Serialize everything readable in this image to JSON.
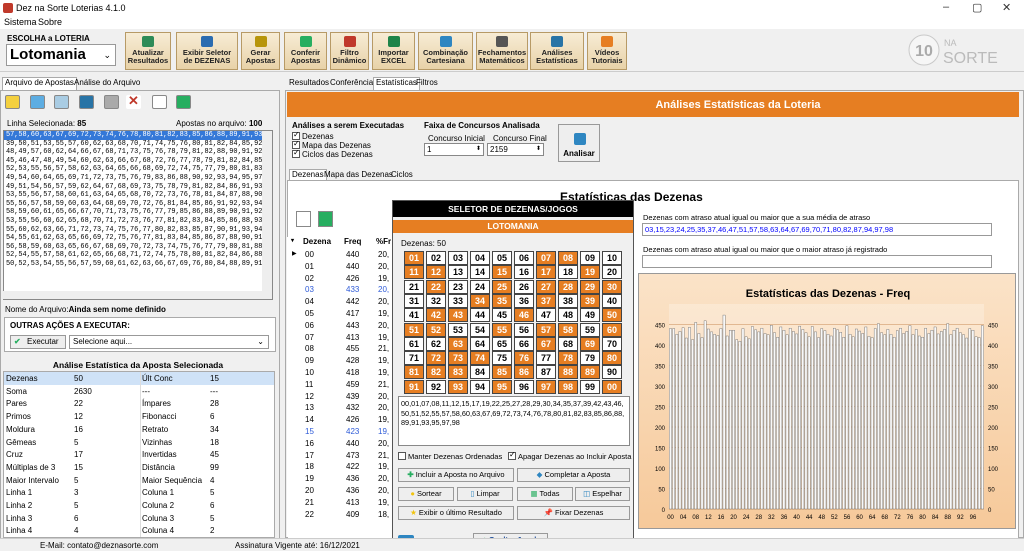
{
  "window": {
    "title": "Dez na Sorte Loterias 4.1.0"
  },
  "menu": [
    "Sistema",
    "Sobre"
  ],
  "loteria": {
    "label": "ESCOLHA a LOTERIA",
    "value": "Lotomania"
  },
  "toolbar": [
    {
      "l1": "Atualizar",
      "l2": "Resultados",
      "icon": "refresh-icon",
      "c": "#2e8b57"
    },
    {
      "l1": "Exibir Seletor",
      "l2": "de DEZENAS",
      "icon": "grid-icon",
      "c": "#2b6cb0"
    },
    {
      "l1": "Gerar",
      "l2": "Apostas",
      "icon": "generate-icon",
      "c": "#b7950b"
    },
    {
      "l1": "Conferir",
      "l2": "Apostas",
      "icon": "check-icon",
      "c": "#27ae60"
    },
    {
      "l1": "Filtro",
      "l2": "Dinâmico",
      "icon": "filter-icon",
      "c": "#c0392b"
    },
    {
      "l1": "Importar",
      "l2": "EXCEL",
      "icon": "excel-icon",
      "c": "#1e8449"
    },
    {
      "l1": "Combinação",
      "l2": "Cartesiana",
      "icon": "combination-icon",
      "c": "#2e86c1"
    },
    {
      "l1": "Fechamentos",
      "l2": "Matemáticos",
      "icon": "sigma-icon",
      "c": "#555555"
    },
    {
      "l1": "Análises",
      "l2": "Estatísticas",
      "icon": "stats-icon",
      "c": "#2874a6"
    },
    {
      "l1": "Vídeos",
      "l2": "Tutoriais",
      "icon": "video-icon",
      "c": "#e67e22"
    }
  ],
  "logo": {
    "num": "10",
    "line1": "NA",
    "line2": "SORTE"
  },
  "left_tabs": [
    "Arquivo de Apostas",
    "Análise do Arquivo"
  ],
  "linha_label": "Linha Selecionada:",
  "linha_value": "85",
  "apostas_label": "Apostas no arquivo:",
  "apostas_value": "100",
  "list_lines": [
    "57,58,60,63,67,69,72,73,74,76,78,80,81,82,83,85,86,88,89,91,93,95,97,98",
    "39,50,51,53,55,57,60,62,63,68,70,71,74,75,76,80,81,82,84,85,92,93,96,98",
    "48,49,57,60,62,64,66,67,68,71,73,75,76,78,79,81,82,88,90,91,92,93,95,98",
    "45,46,47,48,49,54,60,62,63,66,67,68,72,76,77,78,79,81,82,84,85,87,89,94",
    "52,53,55,56,57,58,62,63,64,65,66,68,69,72,74,75,77,79,80,81,83,86,91,96",
    "49,54,60,64,65,69,71,72,73,75,76,79,83,86,88,90,92,93,94,95,97,98,99",
    "49,51,54,56,57,59,62,64,67,68,69,73,75,78,79,81,82,84,86,91,93,95,97,98",
    "53,55,56,57,58,60,61,63,64,65,68,70,72,73,76,78,81,84,87,88,90,95,96,98",
    "55,56,57,58,59,60,63,64,68,69,70,72,76,81,84,85,86,91,92,93,94,95,97,98",
    "58,59,60,61,65,66,67,70,71,73,75,76,77,79,85,86,88,89,90,91,92,93,94,97",
    "53,55,56,60,62,65,68,70,71,72,73,76,77,81,82,83,84,85,86,88,93,94,97,99",
    "55,60,62,63,66,71,72,73,74,75,76,77,80,82,83,85,87,90,91,93,94,95,96,99",
    "54,55,61,62,63,65,66,69,72,75,76,77,81,83,84,85,86,87,88,90,91,92,94,99",
    "56,58,59,60,63,65,66,67,68,69,70,72,73,74,75,76,77,79,80,81,88,96,98,99",
    "52,54,55,57,58,61,62,65,66,68,71,72,74,75,78,80,81,82,84,86,88,89,92,93",
    "50,52,53,54,55,56,57,59,60,61,62,63,66,67,69,76,80,84,88,89,91,92,96,99"
  ],
  "nome_arquivo": {
    "label": "Nome do Arquivo:",
    "value": "Ainda sem nome definido"
  },
  "outras": {
    "title": "OUTRAS AÇÕES A EXECUTAR:",
    "btn": "Executar",
    "placeholder": "Selecione aqui..."
  },
  "analise_title": "Análise Estatística da Aposta Selecionada",
  "stats_rows": [
    [
      "Dezenas",
      "50",
      "Últ Conc",
      "15"
    ],
    [
      "Soma",
      "2630",
      "---",
      "---"
    ],
    [
      "Pares",
      "22",
      "Ímpares",
      "28"
    ],
    [
      "Primos",
      "12",
      "Fibonacci",
      "6"
    ],
    [
      "Moldura",
      "16",
      "Retrato",
      "34"
    ],
    [
      "Gêmeas",
      "5",
      "Vizinhas",
      "18"
    ],
    [
      "Cruz",
      "17",
      "Invertidas",
      "45"
    ],
    [
      "Múltiplas de 3",
      "15",
      "Distância",
      "99"
    ],
    [
      "Maior Intervalo",
      "5",
      "Maior Sequência",
      "4"
    ],
    [
      "Linha 1",
      "3",
      "Coluna 1",
      "5"
    ],
    [
      "Linha 2",
      "5",
      "Coluna 2",
      "6"
    ],
    [
      "Linha 3",
      "6",
      "Coluna 3",
      "5"
    ],
    [
      "Linha 4",
      "4",
      "Coluna 4",
      "2"
    ]
  ],
  "status": {
    "email": "E-Mail: contato@deznasorte.com",
    "assinatura": "Assinatura Vigente até: 16/12/2021"
  },
  "right_tabs": [
    "Resultados",
    "Conferência",
    "Estatísticas",
    "Filtros"
  ],
  "header_title": "Análises Estatísticas da Loteria",
  "analises": {
    "title": "Análises a serem Executadas",
    "items": [
      "Dezenas",
      "Mapa das Dezenas",
      "Ciclos das Dezenas"
    ]
  },
  "faixa": {
    "title": "Faixa de Concursos Analisada",
    "inicial_label": "Concurso Inicial",
    "final_label": "Concurso Final",
    "inicial": "1",
    "final": "2159"
  },
  "analisar": "Analisar",
  "sub_tabs": [
    "Dezenas",
    "Mapa das Dezenas",
    "Ciclos"
  ],
  "est_title": "Estatísticas das Dezenas",
  "grid": {
    "headers": [
      "Dezena",
      "Freq",
      "%Fr"
    ],
    "rows": [
      [
        "00",
        "440",
        "20,"
      ],
      [
        "01",
        "440",
        "20,"
      ],
      [
        "02",
        "426",
        "19,"
      ],
      [
        "03",
        "433",
        "20,"
      ],
      [
        "04",
        "442",
        "20,"
      ],
      [
        "05",
        "417",
        "19,"
      ],
      [
        "06",
        "443",
        "20,"
      ],
      [
        "07",
        "413",
        "19,"
      ],
      [
        "08",
        "455",
        "21,"
      ],
      [
        "09",
        "428",
        "19,"
      ],
      [
        "10",
        "418",
        "19,"
      ],
      [
        "11",
        "459",
        "21,"
      ],
      [
        "12",
        "439",
        "20,"
      ],
      [
        "13",
        "432",
        "20,"
      ],
      [
        "14",
        "426",
        "19,"
      ],
      [
        "15",
        "423",
        "19,"
      ],
      [
        "16",
        "440",
        "20,"
      ],
      [
        "17",
        "473",
        "21,"
      ],
      [
        "18",
        "422",
        "19,"
      ],
      [
        "19",
        "436",
        "20,"
      ],
      [
        "20",
        "436",
        "20,"
      ],
      [
        "21",
        "413",
        "19,"
      ],
      [
        "22",
        "409",
        "18,"
      ]
    ]
  },
  "seletor": {
    "title": "SELETOR DE DEZENAS/JOGOS",
    "lot": "LOTOMANIA",
    "count": "Dezenas: 50",
    "selected": [
      0,
      1,
      7,
      8,
      11,
      12,
      15,
      17,
      19,
      22,
      25,
      27,
      28,
      29,
      30,
      34,
      35,
      37,
      39,
      42,
      43,
      46,
      50,
      51,
      52,
      55,
      57,
      58,
      60,
      63,
      67,
      69,
      72,
      73,
      74,
      76,
      78,
      80,
      81,
      82,
      83,
      85,
      86,
      88,
      89,
      91,
      93,
      95,
      97,
      98
    ],
    "text": "00,01,07,08,11,12,15,17,19,22,25,27,28,29,30,34,35,37,39,42,43,46,50,51,52,55,57,58,60,63,67,69,72,73,74,76,78,80,81,82,83,85,86,88,89,91,93,95,97,98",
    "manter": "Manter Dezenas Ordenadas",
    "apagar": "Apagar Dezenas ao Incluir Aposta",
    "btns": [
      "Incluir a Aposta no Arquivo",
      "Completar a Aposta",
      "Sortear",
      "Limpar",
      "Todas",
      "Espelhar",
      "Exibir o último Resultado",
      "Fixar Dezenas",
      "Ocultar Janela"
    ]
  },
  "right_panel": {
    "l1": "Dezenas com atraso atual igual ou maior que a sua média de atraso",
    "v1": "03,15,23,24,25,35,37,46,47,51,57,58,63,64,67,69,70,71,80,82,87,94,97,98",
    "l2": "Dezenas com atraso atual igual ou maior que o maior atraso já registrado",
    "v2": ""
  },
  "chart_data": {
    "type": "bar",
    "title": "Estatísticas das Dezenas - Freq",
    "ylim": [
      0,
      500
    ],
    "yticks": [
      0,
      50,
      100,
      150,
      200,
      250,
      300,
      350,
      400,
      450
    ],
    "xticks": [
      "00",
      "04",
      "08",
      "12",
      "16",
      "20",
      "24",
      "28",
      "32",
      "36",
      "40",
      "44",
      "48",
      "52",
      "56",
      "60",
      "64",
      "68",
      "72",
      "76",
      "80",
      "84",
      "88",
      "92",
      "96"
    ],
    "categories": [
      "00",
      "01",
      "02",
      "03",
      "04",
      "05",
      "06",
      "07",
      "08",
      "09",
      "10",
      "11",
      "12",
      "13",
      "14",
      "15",
      "16",
      "17",
      "18",
      "19",
      "20",
      "21",
      "22",
      "23",
      "24",
      "25",
      "26",
      "27",
      "28",
      "29",
      "30",
      "31",
      "32",
      "33",
      "34",
      "35",
      "36",
      "37",
      "38",
      "39",
      "40",
      "41",
      "42",
      "43",
      "44",
      "45",
      "46",
      "47",
      "48",
      "49",
      "50",
      "51",
      "52",
      "53",
      "54",
      "55",
      "56",
      "57",
      "58",
      "59",
      "60",
      "61",
      "62",
      "63",
      "64",
      "65",
      "66",
      "67",
      "68",
      "69",
      "70",
      "71",
      "72",
      "73",
      "74",
      "75",
      "76",
      "77",
      "78",
      "79",
      "80",
      "81",
      "82",
      "83",
      "84",
      "85",
      "86",
      "87",
      "88",
      "89",
      "90",
      "91",
      "92",
      "93",
      "94",
      "95",
      "96",
      "97",
      "98",
      "99"
    ],
    "values": [
      440,
      440,
      426,
      433,
      442,
      417,
      443,
      413,
      455,
      428,
      418,
      459,
      439,
      432,
      426,
      423,
      440,
      473,
      422,
      436,
      436,
      413,
      409,
      440,
      420,
      415,
      445,
      437,
      432,
      441,
      428,
      425,
      448,
      430,
      419,
      444,
      436,
      425,
      441,
      433,
      427,
      446,
      438,
      430,
      420,
      445,
      432,
      418,
      440,
      435,
      426,
      422,
      441,
      437,
      431,
      419,
      447,
      426,
      420,
      439,
      434,
      428,
      444,
      421,
      418,
      440,
      452,
      430,
      425,
      438,
      426,
      419,
      435,
      441,
      428,
      433,
      447,
      425,
      438,
      422,
      419,
      441,
      428,
      436,
      444,
      427,
      433,
      438,
      452,
      425,
      436,
      441,
      430,
      425,
      417,
      440,
      436,
      420,
      418,
      447
    ]
  }
}
